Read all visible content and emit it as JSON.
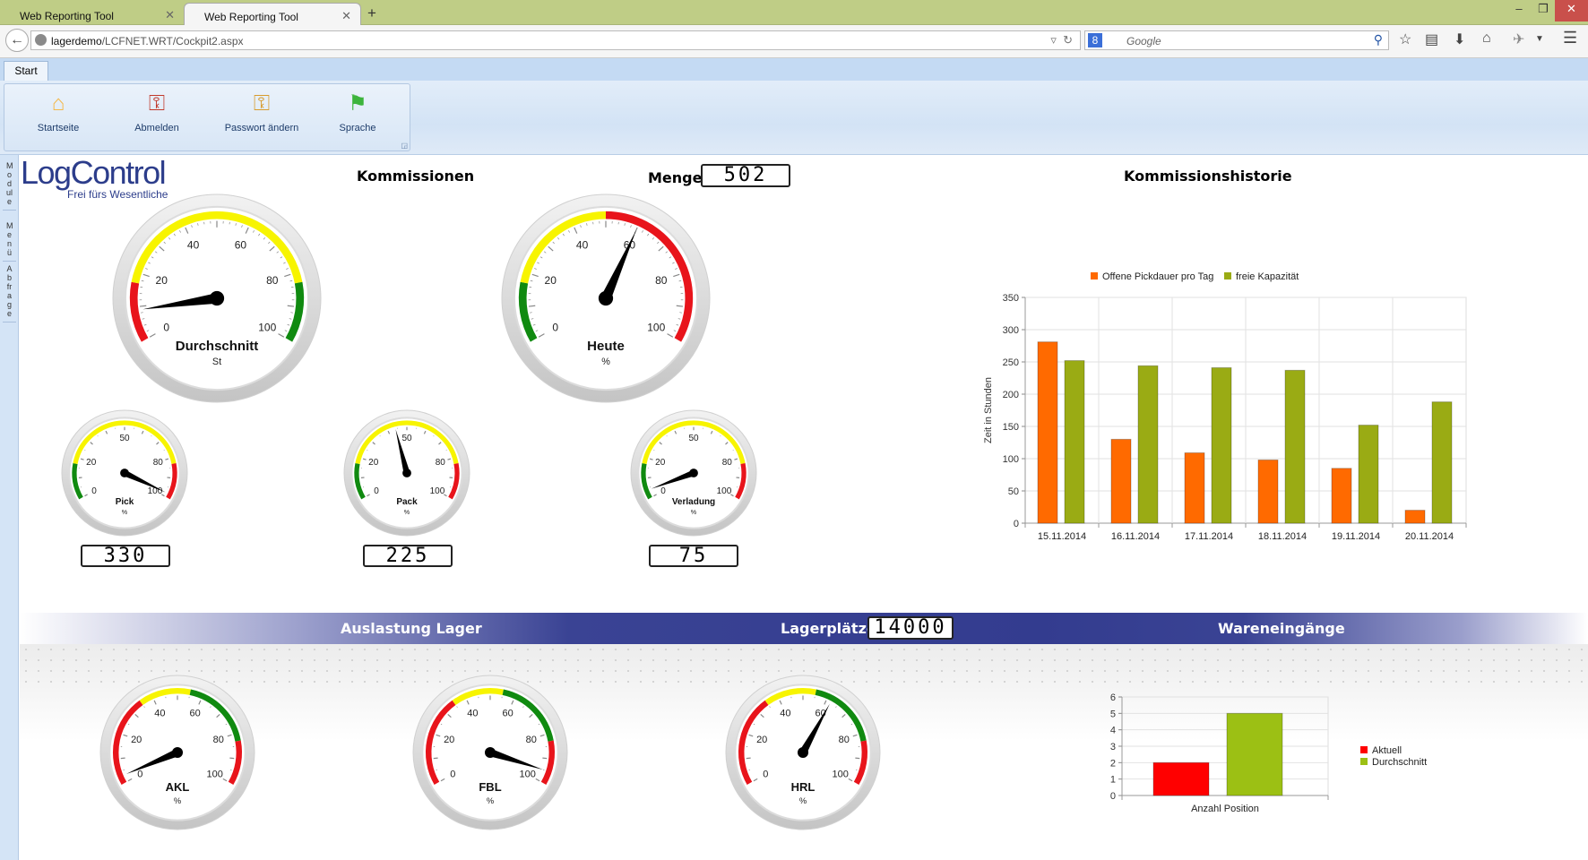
{
  "browser": {
    "tabs": [
      {
        "title": "Web Reporting Tool"
      },
      {
        "title": "Web Reporting Tool"
      }
    ],
    "new_tab": "+",
    "url_host": "lagerdemo",
    "url_path": "/LCFNET.WRT/Cockpit2.aspx",
    "search_placeholder": "Google",
    "window_controls": {
      "minimize": "–",
      "restore": "❐",
      "close": "✕"
    }
  },
  "ribbon": {
    "tab": "Start",
    "buttons": [
      {
        "label": "Startseite",
        "icon": "home-icon"
      },
      {
        "label": "Abmelden",
        "icon": "logout-keys-icon"
      },
      {
        "label": "Passwort ändern",
        "icon": "keys-icon"
      },
      {
        "label": "Sprache",
        "icon": "flag-icon"
      }
    ]
  },
  "sidebar": {
    "items": [
      "Module",
      "Menü",
      "Abfrage"
    ]
  },
  "logo": {
    "name": "LogControl",
    "tagline": "Frei fürs Wesentliche"
  },
  "kommissionen": {
    "title": "Kommissionen",
    "menge_label": "Menge",
    "menge_value": "502",
    "gauges": [
      {
        "title": "Durchschnitt",
        "unit": "St",
        "value": 9,
        "labels": [
          0,
          20,
          40,
          60,
          80,
          100
        ],
        "bands": [
          [
            0,
            17,
            "#e8141b"
          ],
          [
            17,
            83,
            "#f7f400"
          ],
          [
            83,
            100,
            "#108a10"
          ]
        ]
      },
      {
        "title": "Heute",
        "unit": "%",
        "value": 60,
        "labels": [
          0,
          20,
          40,
          60,
          80,
          100
        ],
        "bands": [
          [
            0,
            17,
            "#108a10"
          ],
          [
            17,
            50,
            "#f7f400"
          ],
          [
            50,
            100,
            "#e8141b"
          ]
        ]
      },
      {
        "title": "Pick",
        "unit": "%",
        "value": 98,
        "labels": [
          0,
          20,
          50,
          80,
          100
        ],
        "lcd": "330",
        "bands": [
          [
            0,
            17,
            "#108a10"
          ],
          [
            17,
            83,
            "#f7f400"
          ],
          [
            83,
            100,
            "#e8141b"
          ]
        ]
      },
      {
        "title": "Pack",
        "unit": "%",
        "value": 44,
        "labels": [
          0,
          20,
          50,
          80,
          100
        ],
        "lcd": "225",
        "bands": [
          [
            0,
            17,
            "#108a10"
          ],
          [
            17,
            83,
            "#f7f400"
          ],
          [
            83,
            100,
            "#e8141b"
          ]
        ]
      },
      {
        "title": "Verladung",
        "unit": "%",
        "value": 4,
        "labels": [
          0,
          20,
          50,
          80,
          100
        ],
        "lcd": "75",
        "bands": [
          [
            0,
            17,
            "#108a10"
          ],
          [
            17,
            83,
            "#f7f400"
          ],
          [
            83,
            100,
            "#e8141b"
          ]
        ]
      }
    ]
  },
  "historie": {
    "title": "Kommissionshistorie",
    "chart_data": {
      "type": "bar",
      "categories": [
        "15.11.2014",
        "16.11.2014",
        "17.11.2014",
        "18.11.2014",
        "19.11.2014",
        "20.11.2014"
      ],
      "series": [
        {
          "name": "Offene Pickdauer pro Tag",
          "color": "#ff6a00",
          "values": [
            281,
            130,
            109,
            98,
            85,
            20
          ]
        },
        {
          "name": "freie Kapazität",
          "color": "#9aab14",
          "values": [
            252,
            244,
            241,
            237,
            152,
            188
          ]
        }
      ],
      "ylabel": "Zeit in Stunden",
      "ylim": [
        0,
        350
      ],
      "yticks": [
        0,
        50,
        100,
        150,
        200,
        250,
        300,
        350
      ],
      "grid": true,
      "legend": "top"
    }
  },
  "lager": {
    "title": "Auslastung Lager",
    "lagerplaetze_label": "Lagerplätze",
    "lagerplaetze_value": "14000",
    "gauges": [
      {
        "title": "AKL",
        "unit": "%",
        "value": 3,
        "labels": [
          0,
          20,
          40,
          60,
          80,
          100
        ],
        "bands": [
          [
            0,
            35,
            "#e8141b"
          ],
          [
            35,
            55,
            "#f7f400"
          ],
          [
            55,
            83,
            "#108a10"
          ],
          [
            83,
            100,
            "#e8141b"
          ]
        ]
      },
      {
        "title": "FBL",
        "unit": "%",
        "value": 95,
        "labels": [
          0,
          20,
          40,
          60,
          80,
          100
        ],
        "bands": [
          [
            0,
            35,
            "#e8141b"
          ],
          [
            35,
            55,
            "#f7f400"
          ],
          [
            55,
            83,
            "#108a10"
          ],
          [
            83,
            100,
            "#e8141b"
          ]
        ]
      },
      {
        "title": "HRL",
        "unit": "%",
        "value": 62,
        "labels": [
          0,
          20,
          40,
          60,
          80,
          100
        ],
        "bands": [
          [
            0,
            35,
            "#e8141b"
          ],
          [
            35,
            55,
            "#f7f400"
          ],
          [
            55,
            83,
            "#108a10"
          ],
          [
            83,
            100,
            "#e8141b"
          ]
        ]
      }
    ]
  },
  "wareneingaenge": {
    "title": "Wareneingänge",
    "chart_data": {
      "type": "bar",
      "categories": [
        "Anzahl Position"
      ],
      "series": [
        {
          "name": "Aktuell",
          "color": "#ff0000",
          "values": [
            2
          ]
        },
        {
          "name": "Durchschnitt",
          "color": "#9cc014",
          "values": [
            5
          ]
        }
      ],
      "ylim": [
        0,
        6
      ],
      "yticks": [
        0,
        1,
        2,
        3,
        4,
        5,
        6
      ],
      "grid": true,
      "legend": "right"
    }
  }
}
